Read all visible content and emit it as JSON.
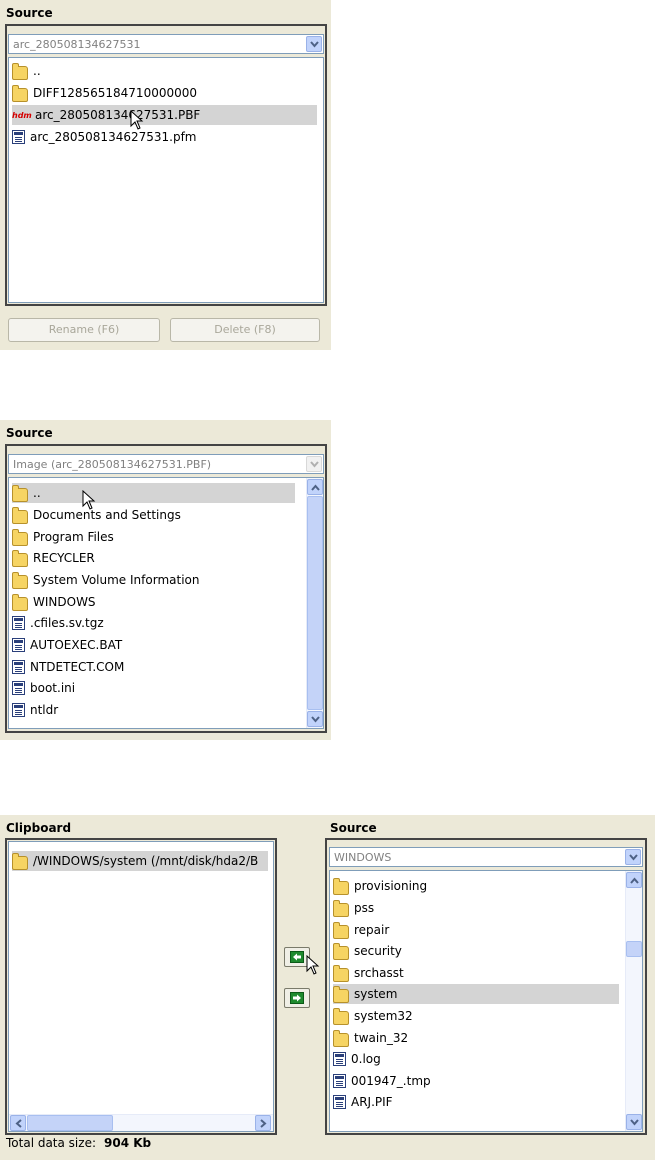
{
  "panel1": {
    "label": "Source",
    "combo_value": "arc_280508134627531",
    "items": [
      {
        "name": "..",
        "icon": "folder-icon"
      },
      {
        "name": "DIFF128565184710000000",
        "icon": "folder-icon"
      },
      {
        "name": "arc_280508134627531.PBF",
        "icon": "pbf-archive-icon",
        "badge": "hdm"
      },
      {
        "name": "arc_280508134627531.pfm",
        "icon": "file-icon"
      }
    ],
    "rename_button": "Rename (F6)",
    "delete_button": "Delete (F8)"
  },
  "panel2": {
    "label": "Source",
    "combo_value": "Image (arc_280508134627531.PBF)",
    "items": [
      {
        "name": "..",
        "icon": "folder-icon"
      },
      {
        "name": "Documents and Settings",
        "icon": "folder-icon"
      },
      {
        "name": "Program Files",
        "icon": "folder-icon"
      },
      {
        "name": "RECYCLER",
        "icon": "folder-icon"
      },
      {
        "name": "System Volume Information",
        "icon": "folder-icon"
      },
      {
        "name": "WINDOWS",
        "icon": "folder-icon"
      },
      {
        "name": ".cfiles.sv.tgz",
        "icon": "file-icon"
      },
      {
        "name": "AUTOEXEC.BAT",
        "icon": "file-icon"
      },
      {
        "name": "NTDETECT.COM",
        "icon": "file-icon"
      },
      {
        "name": "boot.ini",
        "icon": "file-icon"
      },
      {
        "name": "ntldr",
        "icon": "file-icon"
      }
    ]
  },
  "panel3": {
    "clipboard_label": "Clipboard",
    "clipboard_items": [
      {
        "name": "/WINDOWS/system (/mnt/disk/hda2/B",
        "icon": "folder-icon"
      }
    ],
    "source_label": "Source",
    "combo_value": "WINDOWS",
    "items": [
      {
        "name": "provisioning",
        "icon": "folder-icon"
      },
      {
        "name": "pss",
        "icon": "folder-icon"
      },
      {
        "name": "repair",
        "icon": "folder-icon"
      },
      {
        "name": "security",
        "icon": "folder-icon"
      },
      {
        "name": "srchasst",
        "icon": "folder-icon"
      },
      {
        "name": "system",
        "icon": "folder-icon"
      },
      {
        "name": "system32",
        "icon": "folder-icon"
      },
      {
        "name": "twain_32",
        "icon": "folder-icon"
      },
      {
        "name": "0.log",
        "icon": "file-icon"
      },
      {
        "name": "001947_.tmp",
        "icon": "file-icon"
      },
      {
        "name": "ARJ.PIF",
        "icon": "file-icon"
      }
    ],
    "total_label": "Total data size:",
    "total_value": "904 Kb"
  },
  "colors": {
    "panel_bg": "#ece9d8",
    "selection": "#d4d4d4",
    "list_border": "#7f9db9",
    "move_button_green": "#1e8a2e"
  }
}
